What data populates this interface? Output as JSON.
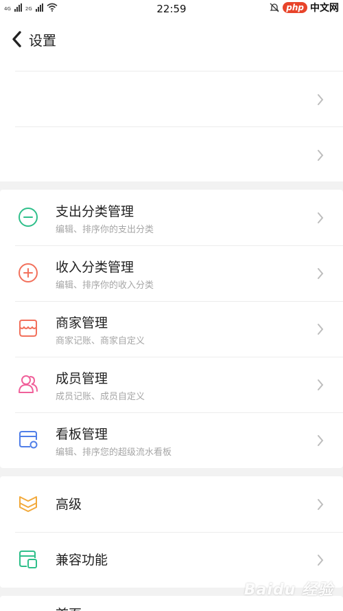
{
  "status_bar": {
    "net1": "4G",
    "net2": "2G",
    "time": "22:59",
    "watermark_logo": "php",
    "watermark_site": "中文网"
  },
  "header": {
    "title": "设置"
  },
  "top_rows": [
    {},
    {}
  ],
  "category_rows": [
    {
      "label": "支出分类管理",
      "sub": "编辑、排序你的支出分类",
      "icon": "minus-circle-icon",
      "color": "#2ebf8a"
    },
    {
      "label": "收入分类管理",
      "sub": "编辑、排序你的收入分类",
      "icon": "plus-circle-icon",
      "color": "#f2705b"
    },
    {
      "label": "商家管理",
      "sub": "商家记账、商家自定义",
      "icon": "shop-icon",
      "color": "#f2705b"
    },
    {
      "label": "成员管理",
      "sub": "成员记账、成员自定义",
      "icon": "members-icon",
      "color": "#f0609a"
    },
    {
      "label": "看板管理",
      "sub": "编辑、排序您的超级流水看板",
      "icon": "board-icon",
      "color": "#4f7ee8"
    }
  ],
  "advanced_rows": [
    {
      "label": "高级",
      "icon": "crown-icon",
      "color": "#f2a93b"
    },
    {
      "label": "兼容功能",
      "icon": "compat-icon",
      "color": "#2ebf8a"
    }
  ],
  "bottom_row": {
    "label": "首页"
  },
  "watermark": "Baidu 经验"
}
